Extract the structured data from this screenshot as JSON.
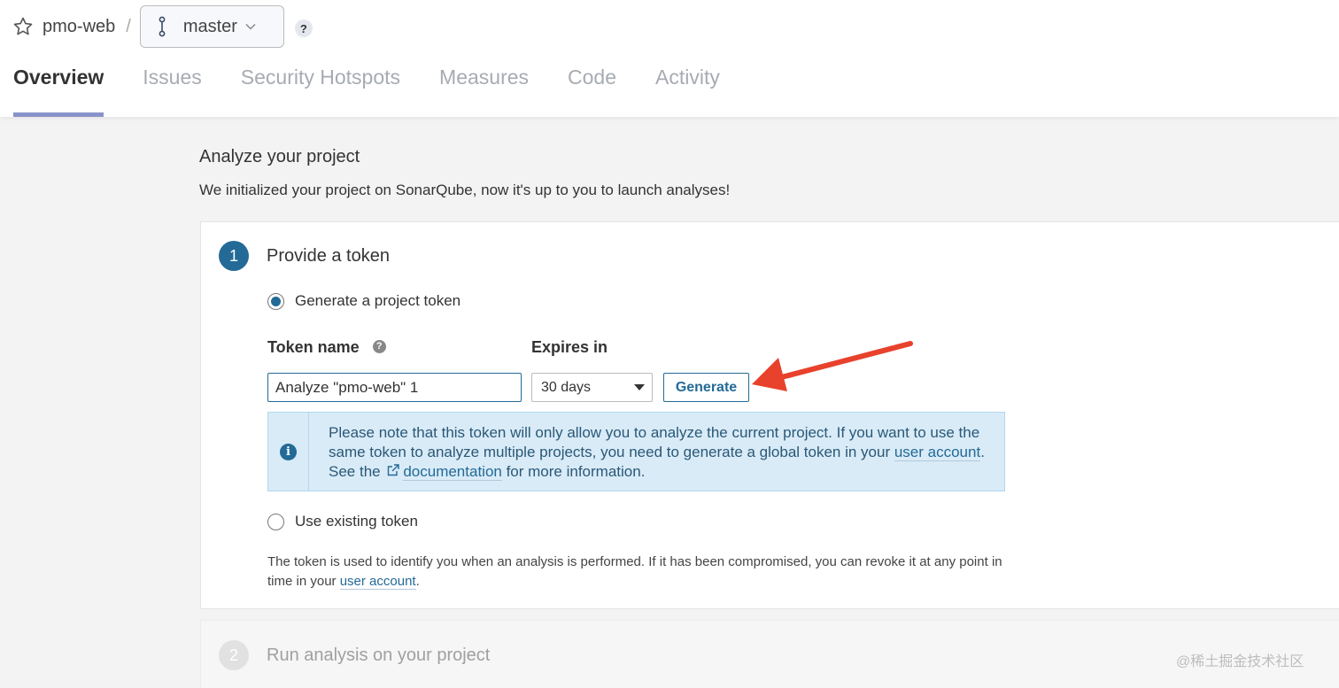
{
  "header": {
    "project_name": "pmo-web",
    "separator": "/",
    "branch_name": "master",
    "help": "?"
  },
  "tabs": [
    {
      "label": "Overview"
    },
    {
      "label": "Issues"
    },
    {
      "label": "Security Hotspots"
    },
    {
      "label": "Measures"
    },
    {
      "label": "Code"
    },
    {
      "label": "Activity"
    }
  ],
  "main": {
    "title": "Analyze your project",
    "subtitle": "We initialized your project on SonarQube, now it's up to you to launch analyses!"
  },
  "step1": {
    "number": "1",
    "title": "Provide a token",
    "option_generate": "Generate a project token",
    "token_name_label": "Token name",
    "expires_label": "Expires in",
    "token_name_value": "Analyze \"pmo-web\" 1",
    "expires_value": "30 days",
    "generate_label": "Generate",
    "alert_text_1": "Please note that this token will only allow you to analyze the current project. If you want to use the same token to analyze multiple projects, you need to generate a global token in your ",
    "alert_link_account": "user account",
    "alert_text_2": ". See the ",
    "alert_link_docs": "documentation",
    "alert_text_3": " for more information.",
    "option_existing": "Use existing token",
    "footer_text_1": "The token is used to identify you when an analysis is performed. If it has been compromised, you can revoke it at any point in time in your ",
    "footer_link": "user account",
    "footer_text_2": "."
  },
  "step2": {
    "number": "2",
    "title": "Run analysis on your project"
  },
  "watermark": "@稀土掘金技术社区",
  "colors": {
    "accent": "#236a97",
    "tab_underline": "#8893c9",
    "alert_bg": "#d9ebf7",
    "annotation_arrow": "#e8412c"
  },
  "icons": [
    "star-icon",
    "branch-icon",
    "chevron-down-icon",
    "help-icon",
    "info-icon",
    "external-link-icon",
    "annotation-arrow-icon"
  ]
}
